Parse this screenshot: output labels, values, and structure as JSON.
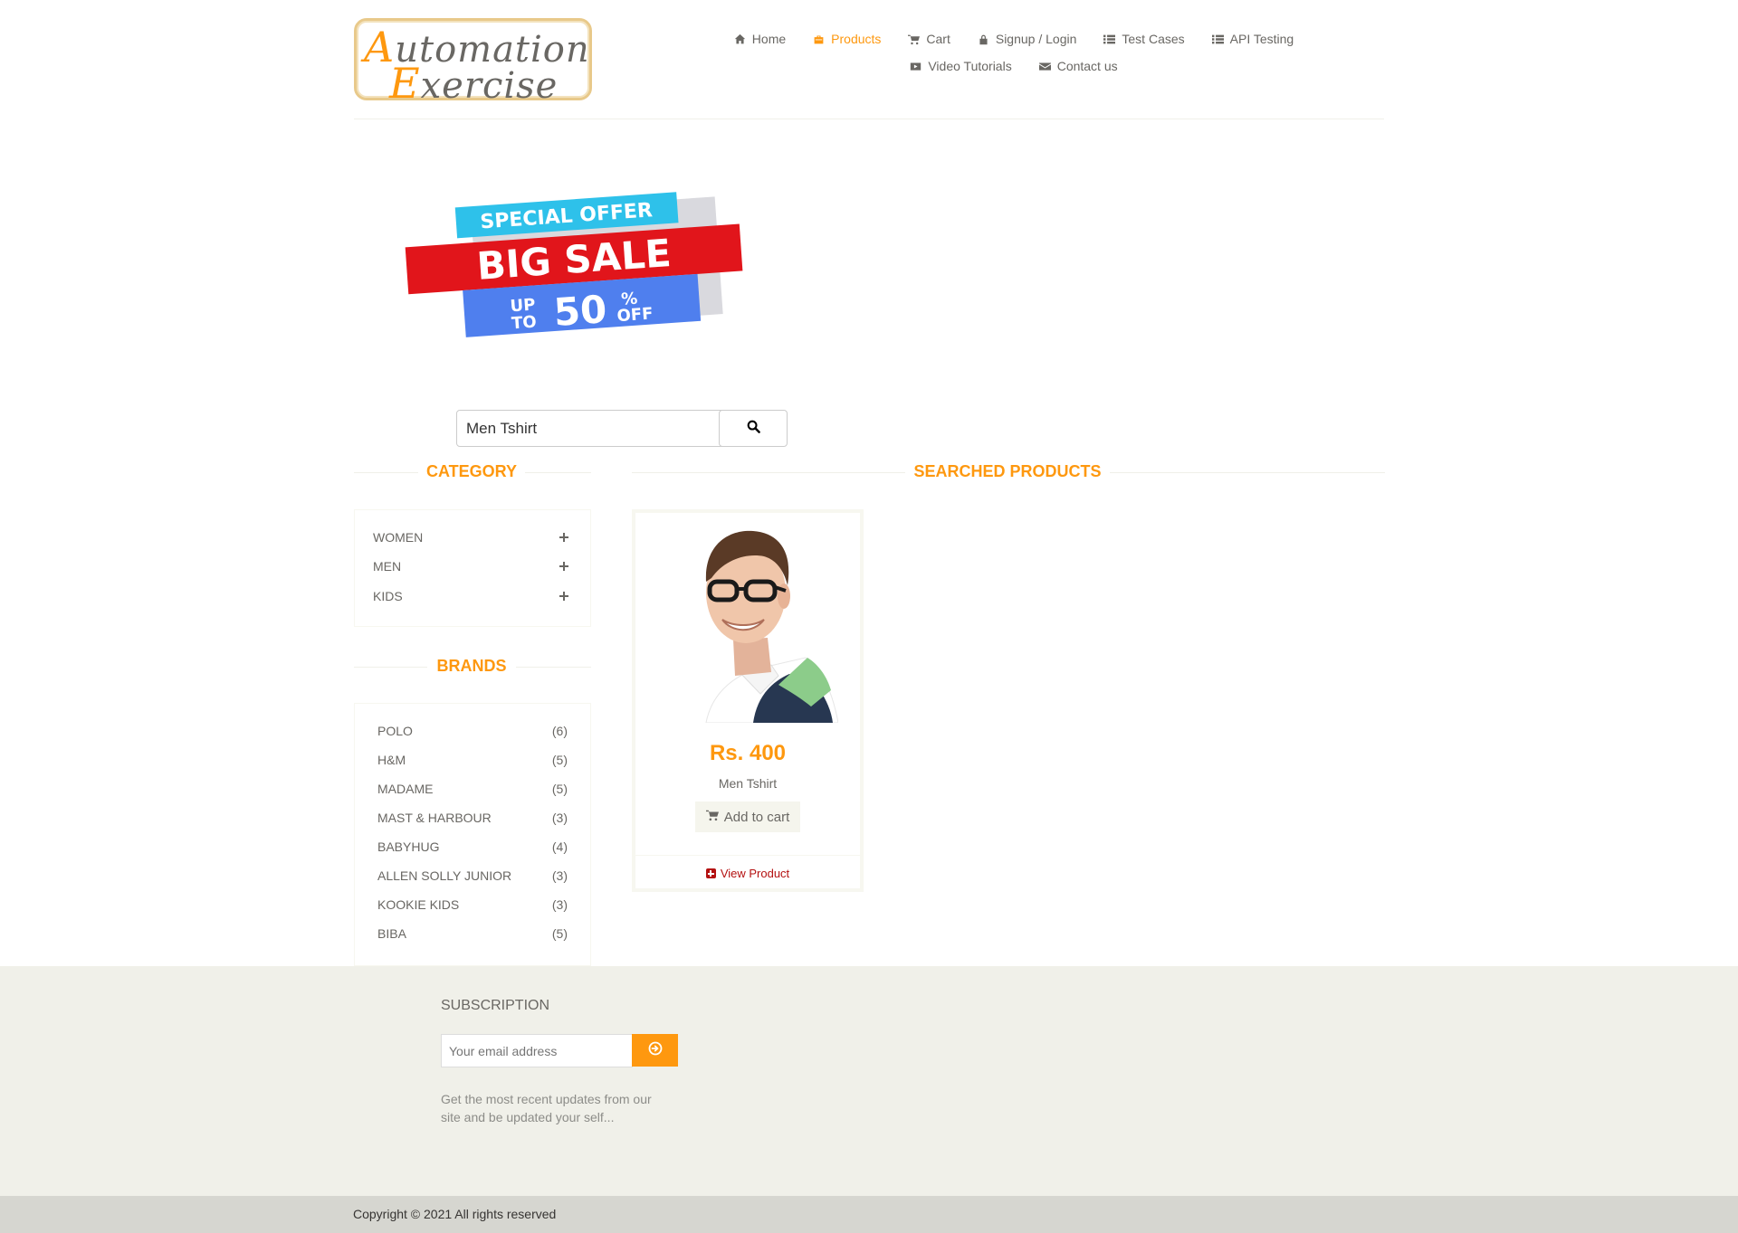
{
  "header": {
    "logo_line1_cap": "A",
    "logo_line1_rest": "utomation",
    "logo_line2_cap": "E",
    "logo_line2_rest": "xercise",
    "nav": [
      {
        "label": "Home",
        "icon": "home-icon"
      },
      {
        "label": "Products",
        "icon": "products-icon",
        "active": true
      },
      {
        "label": "Cart",
        "icon": "cart-icon"
      },
      {
        "label": "Signup / Login",
        "icon": "lock-icon"
      },
      {
        "label": "Test Cases",
        "icon": "list-icon"
      },
      {
        "label": "API Testing",
        "icon": "list-icon"
      },
      {
        "label": "Video Tutorials",
        "icon": "youtube-icon"
      },
      {
        "label": "Contact us",
        "icon": "envelope-icon"
      }
    ]
  },
  "banner": {
    "line1": "SPECIAL OFFER",
    "line2": "BIG SALE",
    "up": "UP",
    "to": "TO",
    "percent": "50",
    "pct_sign": "%",
    "off": "OFF"
  },
  "search": {
    "value": "Men Tshirt"
  },
  "category": {
    "title": "Category",
    "items": [
      {
        "label": "WOMEN"
      },
      {
        "label": "MEN"
      },
      {
        "label": "KIDS"
      }
    ]
  },
  "brands": {
    "title": "Brands",
    "items": [
      {
        "label": "POLO",
        "count": "(6)"
      },
      {
        "label": "H&M",
        "count": "(5)"
      },
      {
        "label": "MADAME",
        "count": "(5)"
      },
      {
        "label": "MAST & HARBOUR",
        "count": "(3)"
      },
      {
        "label": "BABYHUG",
        "count": "(4)"
      },
      {
        "label": "ALLEN SOLLY JUNIOR",
        "count": "(3)"
      },
      {
        "label": "KOOKIE KIDS",
        "count": "(3)"
      },
      {
        "label": "BIBA",
        "count": "(5)"
      }
    ]
  },
  "results": {
    "title": "Searched Products",
    "products": [
      {
        "price": "Rs. 400",
        "name": "Men Tshirt",
        "add_to_cart": "Add to cart",
        "view": "View Product"
      }
    ]
  },
  "footer": {
    "subscription_title": "SUBSCRIPTION",
    "email_placeholder": "Your email address",
    "note": "Get the most recent updates from our site and be updated your self...",
    "copyright": "Copyright © 2021 All rights reserved"
  },
  "colors": {
    "accent": "#FE980F",
    "text": "#696763",
    "footer_bg": "#F0F0E9",
    "view_product": "#B41111"
  }
}
